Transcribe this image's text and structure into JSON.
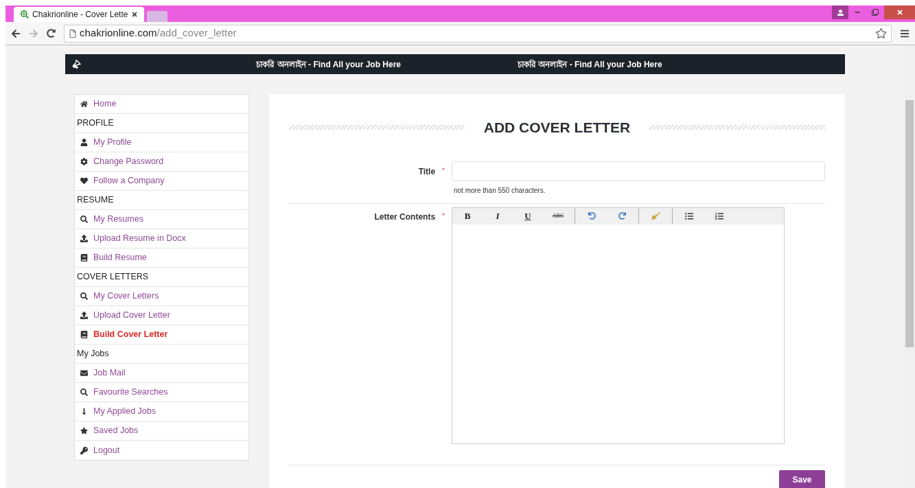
{
  "browser": {
    "tab_title": "Chakrionline - Cover Lette",
    "url_host": "chakrionline.com",
    "url_path": "/add_cover_letter"
  },
  "banner": {
    "texts": [
      "চাকরি অনলাইন - Find All your Job Here",
      "চাকরি অনলাইন - Find All your Job Here"
    ]
  },
  "sidebar": {
    "items": [
      {
        "kind": "link",
        "label": "Home",
        "selected": false
      },
      {
        "kind": "header",
        "label": "PROFILE"
      },
      {
        "kind": "link",
        "label": "My Profile",
        "selected": false
      },
      {
        "kind": "link",
        "label": "Change Password",
        "selected": false
      },
      {
        "kind": "link",
        "label": "Follow a Company",
        "selected": false
      },
      {
        "kind": "header",
        "label": "RESUME"
      },
      {
        "kind": "link",
        "label": "My Resumes",
        "selected": false
      },
      {
        "kind": "link",
        "label": "Upload Resume in Docx",
        "selected": false
      },
      {
        "kind": "link",
        "label": "Build Resume",
        "selected": false
      },
      {
        "kind": "header",
        "label": "COVER LETTERS"
      },
      {
        "kind": "link",
        "label": "My Cover Letters",
        "selected": false
      },
      {
        "kind": "link",
        "label": "Upload Cover Letter",
        "selected": false
      },
      {
        "kind": "link",
        "label": "Build Cover Letter",
        "selected": true
      },
      {
        "kind": "header",
        "label": "My Jobs"
      },
      {
        "kind": "link",
        "label": "Job Mail",
        "selected": false
      },
      {
        "kind": "link",
        "label": "Favourite Searches",
        "selected": false
      },
      {
        "kind": "link",
        "label": "My Applied Jobs",
        "selected": false
      },
      {
        "kind": "link",
        "label": "Saved Jobs",
        "selected": false
      },
      {
        "kind": "link",
        "label": "Logout",
        "selected": false
      }
    ]
  },
  "form": {
    "heading": "ADD COVER LETTER",
    "title_field": {
      "label": "Title",
      "required_mark": "*",
      "hint": "not more than 550 characters."
    },
    "contents_field": {
      "label": "Letter Contents",
      "required_mark": "*",
      "toolbar": [
        [
          {
            "kind": "bold",
            "label": "B"
          },
          {
            "kind": "italic",
            "label": "I"
          },
          {
            "kind": "underline",
            "label": "U"
          },
          {
            "kind": "strike",
            "label": "ABC"
          }
        ],
        [
          {
            "kind": "undo"
          },
          {
            "kind": "redo"
          }
        ],
        [
          {
            "kind": "clean"
          }
        ],
        [
          {
            "kind": "bullets"
          },
          {
            "kind": "numbers"
          }
        ]
      ]
    },
    "save_button": "Save"
  }
}
